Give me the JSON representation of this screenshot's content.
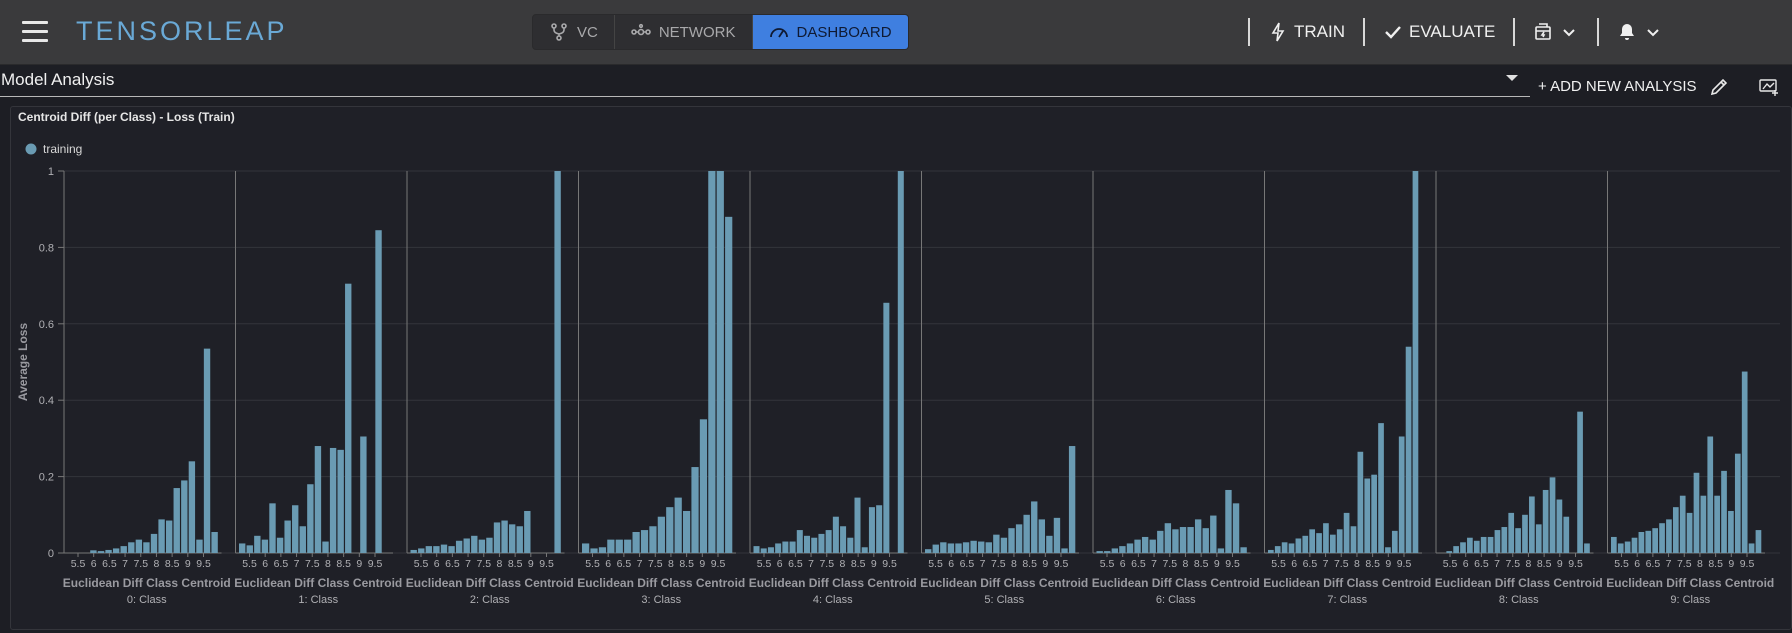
{
  "app": {
    "logo": "TENSORLEAP"
  },
  "header": {
    "tabs": [
      {
        "label": "VC",
        "icon": "git-branch-icon",
        "active": false
      },
      {
        "label": "NETWORK",
        "icon": "network-icon",
        "active": false
      },
      {
        "label": "DASHBOARD",
        "icon": "speedometer-icon",
        "active": true
      }
    ],
    "train_label": "TRAIN",
    "evaluate_label": "EVALUATE"
  },
  "subbar": {
    "analysis_value": "Model Analysis",
    "add_label": "+ ADD NEW ANALYSIS"
  },
  "colors": {
    "accent": "#3f7fe0",
    "bar": "#6a9bb3",
    "logo": "#6aa9d6"
  },
  "chart_data": {
    "type": "bar",
    "title": "Centroid Diff (per Class) - Loss (Train)",
    "ylabel": "Average Loss",
    "ylim": [
      0,
      1
    ],
    "yticks": [
      "0",
      "0.2",
      "0.4",
      "0.6",
      "0.8",
      "1"
    ],
    "legend": [
      {
        "name": "training",
        "color": "#6a9bb3"
      }
    ],
    "legend_position": "top-left",
    "grid": true,
    "xlabel": "Euclidean Diff Class Centroid",
    "xticks": [
      "5.5",
      "6",
      "6.5",
      "7",
      "7.5",
      "8",
      "8.5",
      "9",
      "9.5"
    ],
    "series": [
      {
        "name": "0: Class",
        "values": [
          0.0,
          0.0,
          0.0,
          0.007,
          0.005,
          0.008,
          0.012,
          0.018,
          0.028,
          0.035,
          0.028,
          0.05,
          0.088,
          0.085,
          0.17,
          0.19,
          0.24,
          0.035,
          0.535,
          0.055
        ]
      },
      {
        "name": "1: Class",
        "values": [
          0.025,
          0.02,
          0.045,
          0.035,
          0.13,
          0.04,
          0.085,
          0.125,
          0.07,
          0.18,
          0.28,
          0.03,
          0.275,
          0.27,
          0.705,
          0.0,
          0.305,
          0.0,
          0.845,
          0.0
        ]
      },
      {
        "name": "2: Class",
        "values": [
          0.008,
          0.012,
          0.018,
          0.018,
          0.022,
          0.018,
          0.032,
          0.038,
          0.045,
          0.035,
          0.04,
          0.08,
          0.085,
          0.075,
          0.07,
          0.11,
          0.0,
          0.0,
          0.0,
          1.0
        ]
      },
      {
        "name": "3: Class",
        "values": [
          0.025,
          0.012,
          0.015,
          0.035,
          0.035,
          0.035,
          0.055,
          0.06,
          0.07,
          0.095,
          0.12,
          0.145,
          0.11,
          0.225,
          0.35,
          1.0,
          1.0,
          0.88
        ]
      },
      {
        "name": "4: Class",
        "values": [
          0.018,
          0.012,
          0.015,
          0.025,
          0.03,
          0.03,
          0.06,
          0.045,
          0.04,
          0.05,
          0.06,
          0.095,
          0.07,
          0.04,
          0.145,
          0.015,
          0.12,
          0.125,
          0.655,
          0.0,
          1.0
        ]
      },
      {
        "name": "5: Class",
        "values": [
          0.01,
          0.022,
          0.028,
          0.025,
          0.025,
          0.028,
          0.032,
          0.03,
          0.028,
          0.048,
          0.04,
          0.065,
          0.075,
          0.1,
          0.135,
          0.088,
          0.045,
          0.092,
          0.012,
          0.28
        ]
      },
      {
        "name": "6: Class",
        "values": [
          0.005,
          0.005,
          0.012,
          0.018,
          0.025,
          0.035,
          0.042,
          0.035,
          0.058,
          0.078,
          0.062,
          0.068,
          0.068,
          0.088,
          0.065,
          0.098,
          0.012,
          0.165,
          0.13,
          0.015
        ]
      },
      {
        "name": "7: Class",
        "values": [
          0.008,
          0.018,
          0.028,
          0.025,
          0.038,
          0.045,
          0.062,
          0.052,
          0.078,
          0.048,
          0.062,
          0.105,
          0.07,
          0.265,
          0.195,
          0.205,
          0.34,
          0.015,
          0.058,
          0.305,
          0.54,
          1.0
        ]
      },
      {
        "name": "8: Class",
        "values": [
          0.0,
          0.005,
          0.018,
          0.028,
          0.04,
          0.032,
          0.042,
          0.042,
          0.06,
          0.068,
          0.105,
          0.065,
          0.1,
          0.148,
          0.075,
          0.165,
          0.198,
          0.14,
          0.095,
          0.0,
          0.37,
          0.025
        ]
      },
      {
        "name": "9: Class",
        "values": [
          0.042,
          0.025,
          0.03,
          0.04,
          0.055,
          0.058,
          0.065,
          0.078,
          0.088,
          0.12,
          0.15,
          0.105,
          0.21,
          0.15,
          0.305,
          0.15,
          0.215,
          0.11,
          0.26,
          0.475,
          0.025,
          0.06
        ]
      }
    ]
  }
}
